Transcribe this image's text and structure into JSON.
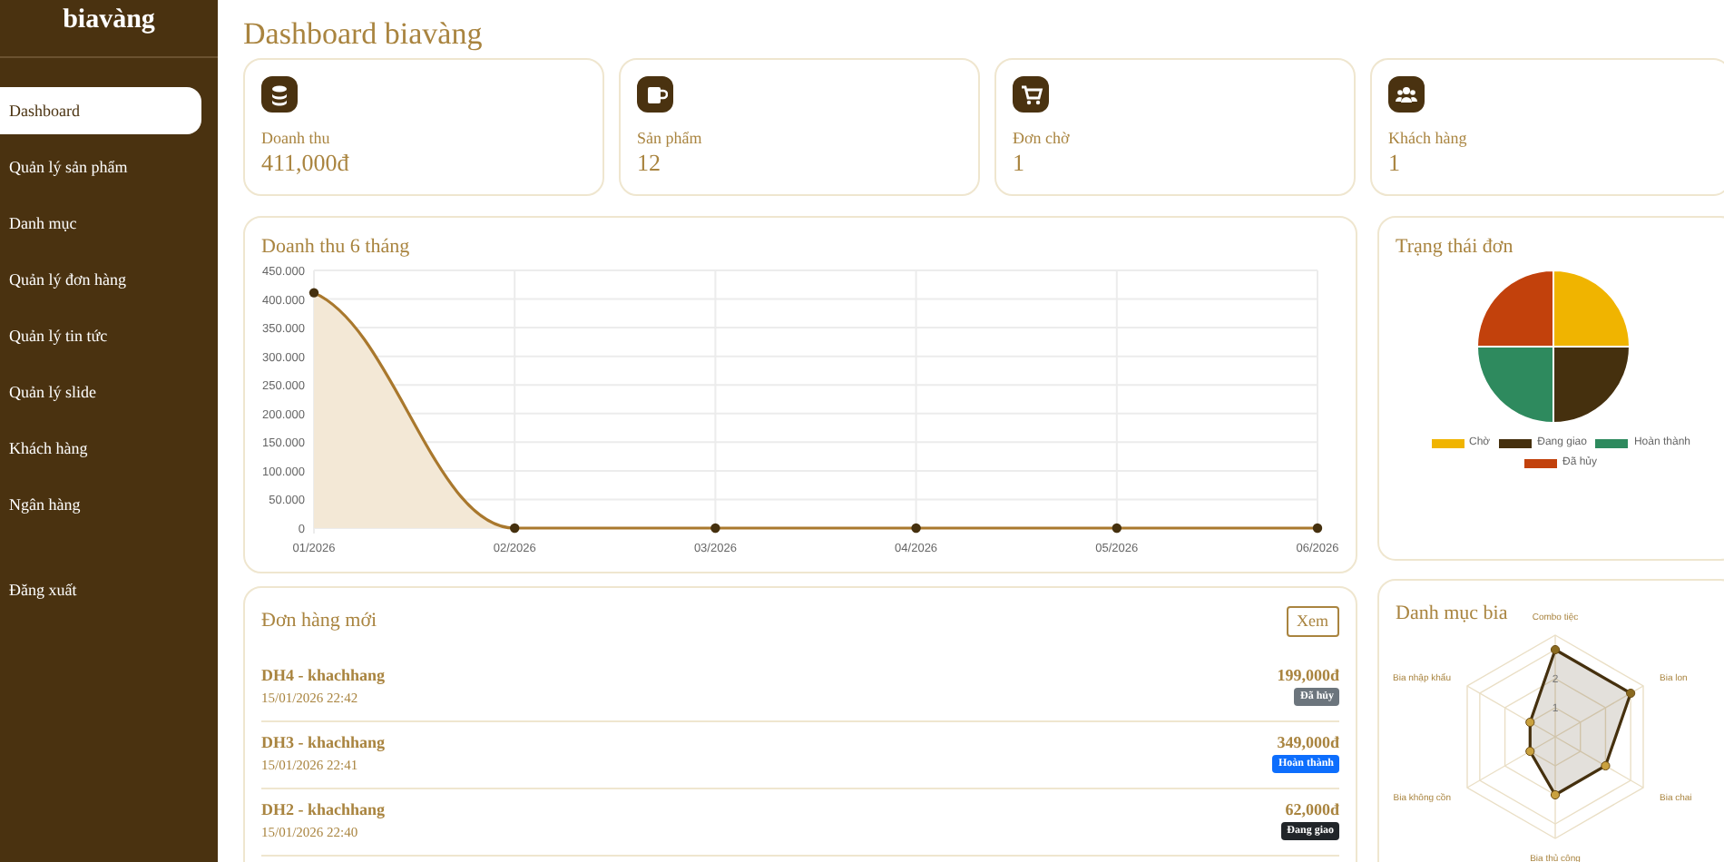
{
  "sidebar": {
    "brand": "biavàng",
    "items": [
      {
        "label": "Dashboard",
        "selected": true
      },
      {
        "label": "Quản lý sản phẩm",
        "selected": false
      },
      {
        "label": "Danh mục",
        "selected": false
      },
      {
        "label": "Quản lý đơn hàng",
        "selected": false
      },
      {
        "label": "Quản lý tin tức",
        "selected": false
      },
      {
        "label": "Quản lý slide",
        "selected": false
      },
      {
        "label": "Khách hàng",
        "selected": false
      },
      {
        "label": "Ngân hàng",
        "selected": false
      }
    ],
    "logout": "Đăng xuất"
  },
  "page_title": "Dashboard biavàng",
  "stats": [
    {
      "kind": "coins",
      "label": "Doanh thu",
      "value": "411,000đ"
    },
    {
      "kind": "mug",
      "label": "Sản phẩm",
      "value": "12"
    },
    {
      "kind": "cart",
      "label": "Đơn chờ",
      "value": "1"
    },
    {
      "kind": "users",
      "label": "Khách hàng",
      "value": "1"
    }
  ],
  "revenue_chart": {
    "title": "Doanh thu 6 tháng",
    "chart_data": {
      "type": "area",
      "categories": [
        "01/2026",
        "02/2026",
        "03/2026",
        "04/2026",
        "05/2026",
        "06/2026"
      ],
      "series": [
        {
          "color": "#a9782d",
          "values": [
            411000,
            0,
            0,
            0,
            0,
            0
          ]
        }
      ],
      "grid": true,
      "ylim": [
        0,
        450000
      ],
      "yticks": [
        {
          "value": 0,
          "label": "0"
        },
        {
          "value": 50000,
          "label": "50.000"
        },
        {
          "value": 100000,
          "label": "100.000"
        },
        {
          "value": 150000,
          "label": "150.000"
        },
        {
          "value": 200000,
          "label": "200.000"
        },
        {
          "value": 250000,
          "label": "250.000"
        },
        {
          "value": 300000,
          "label": "300.000"
        },
        {
          "value": 350000,
          "label": "350.000"
        },
        {
          "value": 400000,
          "label": "400.000"
        },
        {
          "value": 450000,
          "label": "450.000"
        }
      ]
    }
  },
  "status_chart": {
    "title": "Trạng thái đơn",
    "chart_data": {
      "type": "pie",
      "categories": [
        "Chờ",
        "Đang giao",
        "Hoàn thành",
        "Đã hủy"
      ],
      "values": [
        25,
        25,
        25,
        25
      ],
      "colors": [
        "#f0b400",
        "#45300e",
        "#2e8a5e",
        "#c2410c"
      ],
      "legend": true
    }
  },
  "orders": {
    "title": "Đơn hàng mới",
    "button": "Xem",
    "items": [
      {
        "title": "DH4 - khachhang",
        "time": "15/01/2026 22:42",
        "amount": "199,000đ",
        "status": "Đã hủy",
        "kind": "cancelled"
      },
      {
        "title": "DH3 - khachhang",
        "time": "15/01/2026 22:41",
        "amount": "349,000đ",
        "status": "Hoàn thành",
        "kind": "done"
      },
      {
        "title": "DH2 - khachhang",
        "time": "15/01/2026 22:40",
        "amount": "62,000đ",
        "status": "Đang giao",
        "kind": "shipping"
      }
    ]
  },
  "category_chart": {
    "title": "Danh mục bia",
    "chart_data": {
      "type": "radar",
      "categories": [
        "Combo tiệc",
        "Bia lon",
        "Bia chai",
        "Bia thủ công",
        "Bia không cồn",
        "Bia nhập khẩu"
      ],
      "series": [
        {
          "color": "#45300e",
          "values": [
            3,
            3,
            2,
            2,
            1,
            1
          ]
        }
      ],
      "yticks": [
        {
          "value": 1,
          "label": "1"
        },
        {
          "value": 2,
          "label": "2"
        }
      ],
      "ylim": [
        0,
        3.5
      ]
    }
  }
}
